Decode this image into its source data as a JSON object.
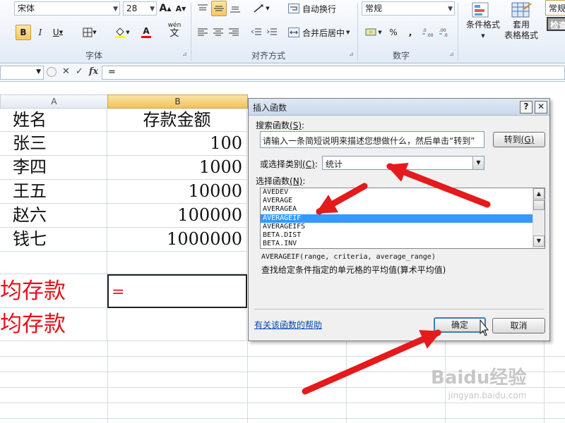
{
  "ribbon": {
    "font_name": "宋体",
    "font_size": "28",
    "grow_font": "A",
    "shrink_font": "A",
    "bold": "B",
    "italic": "I",
    "underline": "U",
    "font_color_letter": "A",
    "phonetic": "wén",
    "phonetic_char": "文",
    "wrap_text": "自动换行",
    "merge_center": "合并后居中",
    "number_format": "常规",
    "percent": "%",
    "comma": ",",
    "cond_format": "条件格式",
    "table_format_l1": "套用",
    "table_format_l2": "表格格式",
    "style_normal": "常规",
    "style_check": "检查",
    "groups": {
      "font": "字体",
      "alignment": "对齐方式",
      "number": "数字"
    }
  },
  "formula_bar": {
    "cancel": "✕",
    "enter": "✓",
    "fx": "fx",
    "content": "="
  },
  "sheet": {
    "columns": [
      "A",
      "B"
    ],
    "header": {
      "name": "姓名",
      "amount": "存款金额"
    },
    "rows": [
      {
        "name": "张三",
        "amount": "100"
      },
      {
        "name": "李四",
        "amount": "1000"
      },
      {
        "name": "王五",
        "amount": "10000"
      },
      {
        "name": "赵六",
        "amount": "100000"
      },
      {
        "name": "钱七",
        "amount": "1000000"
      }
    ],
    "label_avg1": "人均存款",
    "label_avg2": "人均存款",
    "edit_value": "="
  },
  "dialog": {
    "title": "插入函数",
    "help_btn": "?",
    "close_btn": "✕",
    "search_label": "搜索函数",
    "search_key": "(S)",
    "search_value": "请输入一条简短说明来描述您想做什么，然后单击“转到”",
    "go_button": "转到",
    "go_key": "(G)",
    "category_label": "或选择类别",
    "category_key": "(C)",
    "category_value": "统计",
    "select_label": "选择函数",
    "select_key": "(N)",
    "functions": [
      "AVEDEV",
      "AVERAGE",
      "AVERAGEA",
      "AVERAGEIF",
      "AVERAGEIFS",
      "BETA.DIST",
      "BETA.INV"
    ],
    "selected_function": "AVERAGEIF",
    "signature": "AVERAGEIF(range, criteria, average_range)",
    "description": "查找给定条件指定的单元格的平均值(算术平均值)",
    "help_link": "有关该函数的帮助",
    "ok": "确定",
    "cancel": "取消"
  },
  "watermark": {
    "line1": "Baidu经验",
    "line2": "jingyan.baidu.com"
  },
  "colors": {
    "arrow_red": "#e41a1c",
    "selection_blue": "#3399ff",
    "red_text": "#e8101a"
  }
}
